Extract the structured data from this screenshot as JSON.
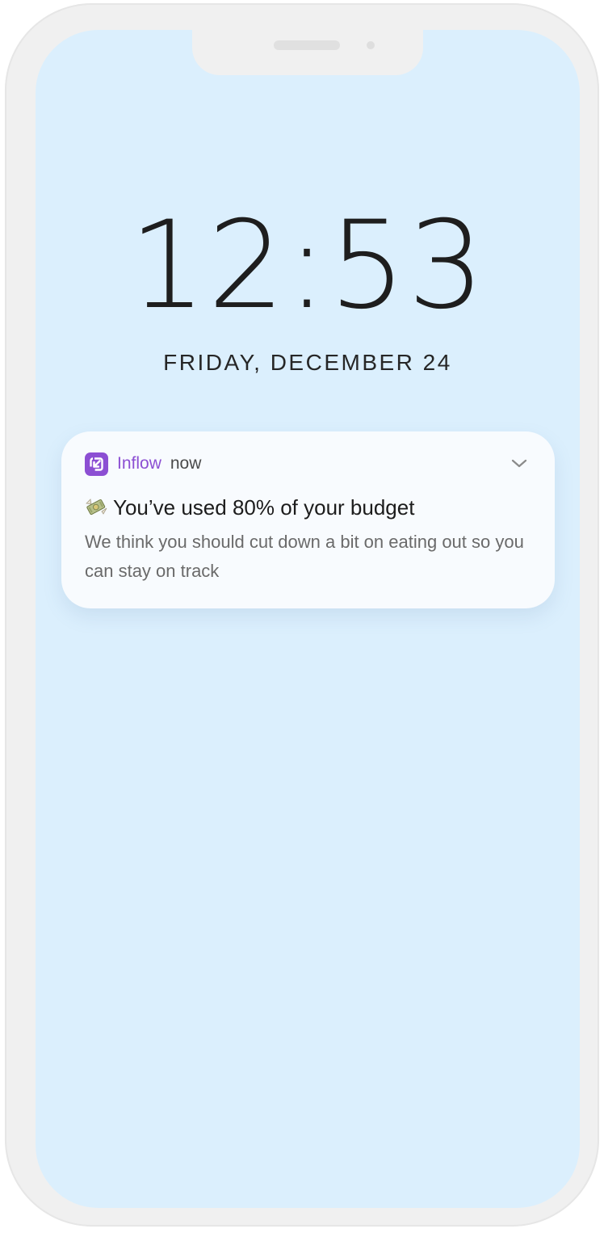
{
  "lockscreen": {
    "time": "12:53",
    "date": "FRIDAY, DECEMBER 24"
  },
  "notification": {
    "app_icon": "arrow-down-left-icon",
    "app_name": "Inflow",
    "timestamp": "now",
    "expand_icon": "chevron-down-icon",
    "title_icon": "money-with-wings-icon",
    "title": "You’ve used 80% of your budget",
    "body": "We think you should cut down a bit on eating out so you can stay on track"
  },
  "colors": {
    "screen_background": "#dbeffd",
    "accent": "#8c4fd3",
    "card_background": "#f8fbfe",
    "frame": "#f0f0f0"
  }
}
